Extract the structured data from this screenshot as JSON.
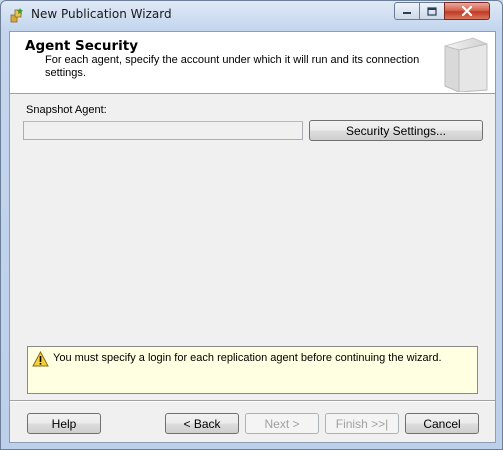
{
  "window": {
    "title": "New Publication Wizard",
    "controls": {
      "minimize_icon": "minimize-icon",
      "maximize_icon": "maximize-icon",
      "close_icon": "close-icon"
    }
  },
  "header": {
    "title": "Agent Security",
    "description": "For each agent, specify the account under which it will run and its connection settings."
  },
  "snapshot_agent": {
    "label": "Snapshot Agent:",
    "value": "",
    "button_label": "Security Settings..."
  },
  "warning": {
    "icon": "warning-icon",
    "text": "You must specify a login for each replication agent before continuing the wizard."
  },
  "buttons": {
    "help": "Help",
    "back": "< Back",
    "next": "Next >",
    "finish": "Finish >>|",
    "cancel": "Cancel"
  },
  "colors": {
    "window_frame": "#c4d6ee",
    "warning_background": "#ffffe1",
    "close_button": "#c23a22"
  }
}
